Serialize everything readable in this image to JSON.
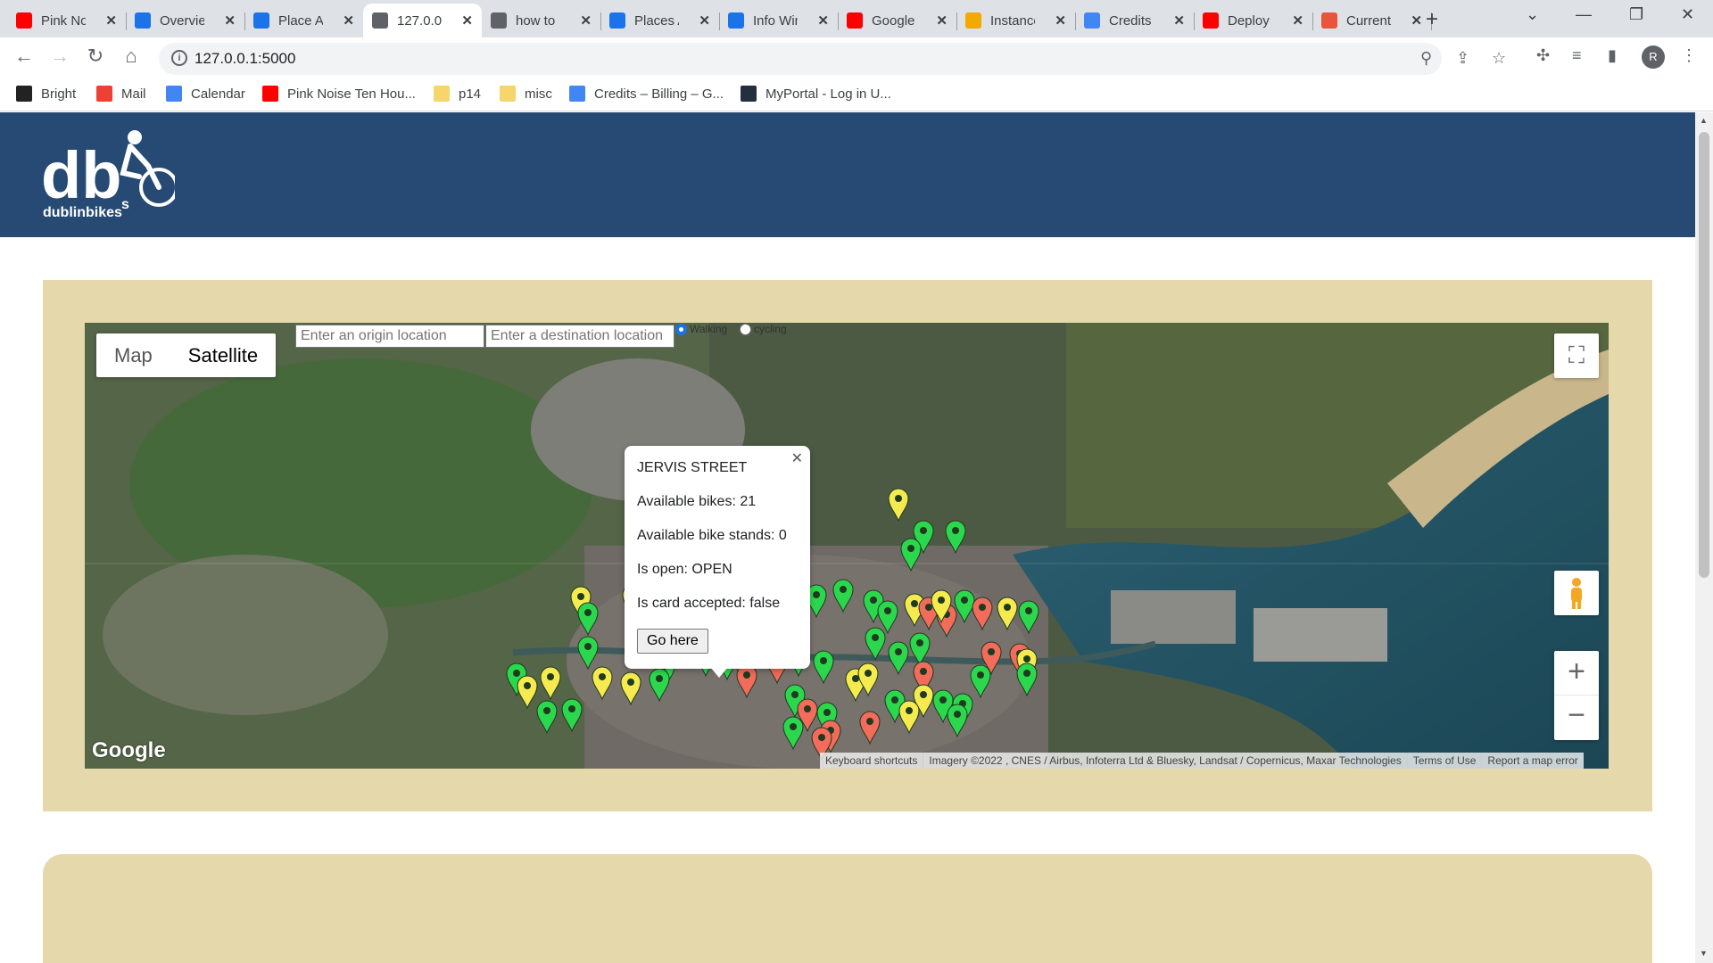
{
  "browser": {
    "tabs": [
      {
        "title": "Pink Noise",
        "favicon": "youtube-icon",
        "color": "#ff0000"
      },
      {
        "title": "Overview",
        "favicon": "cloud-dev-icon",
        "color": "#1a73e8"
      },
      {
        "title": "Place API",
        "favicon": "cloud-dev-icon",
        "color": "#1a73e8"
      },
      {
        "title": "127.0.0.1",
        "favicon": "globe-icon",
        "color": "#5f6368"
      },
      {
        "title": "how to",
        "favicon": "globe-icon",
        "color": "#5f6368"
      },
      {
        "title": "Places API",
        "favicon": "cloud-dev-icon",
        "color": "#1a73e8"
      },
      {
        "title": "Info Window",
        "favicon": "cloud-dev-icon",
        "color": "#1a73e8"
      },
      {
        "title": "Google",
        "favicon": "youtube-icon",
        "color": "#ff0000"
      },
      {
        "title": "Instances",
        "favicon": "box-icon",
        "color": "#f2a900"
      },
      {
        "title": "Credits",
        "favicon": "billing-icon",
        "color": "#4285f4"
      },
      {
        "title": "Deploy",
        "favicon": "youtube-icon",
        "color": "#ff0000"
      },
      {
        "title": "Current",
        "favicon": "octopus-icon",
        "color": "#e8553a"
      }
    ],
    "active_tab_index": 3,
    "url": "127.0.0.1:5000",
    "profile_initial": "R",
    "bookmarks": [
      {
        "label": "Bright",
        "icon": "d2l-icon",
        "color": "#222222"
      },
      {
        "label": "Mail",
        "icon": "gmail-icon",
        "color": "#ea4335"
      },
      {
        "label": "Calendar",
        "icon": "calendar-icon",
        "color": "#4285f4"
      },
      {
        "label": "Pink Noise Ten Hou...",
        "icon": "youtube-icon",
        "color": "#ff0000"
      },
      {
        "label": "p14",
        "icon": "folder-icon",
        "color": "#f6d56a"
      },
      {
        "label": "misc",
        "icon": "folder-icon",
        "color": "#f6d56a"
      },
      {
        "label": "Credits – Billing – G...",
        "icon": "billing-icon",
        "color": "#4285f4"
      },
      {
        "label": "MyPortal - Log in U...",
        "icon": "amazon-icon",
        "color": "#232f3e"
      }
    ]
  },
  "site": {
    "brand": "dublinbikes",
    "logo_letters": "db",
    "logo_sub": "s",
    "header_color": "#264a73",
    "panel_color": "#e5d8aa"
  },
  "map": {
    "type_controls": {
      "map": "Map",
      "satellite": "Satellite",
      "selected": "Satellite"
    },
    "origin_placeholder": "Enter an origin location",
    "destination_placeholder": "Enter a destination location",
    "travel_modes": [
      {
        "label": "Walking",
        "checked": true
      },
      {
        "label": "cycling",
        "checked": false
      }
    ],
    "google_logo": "Google",
    "attribution": [
      "Keyboard shortcuts",
      "Imagery ©2022 , CNES / Airbus, Infoterra Ltd & Bluesky, Landsat / Copernicus, Maxar Technologies",
      "Terms of Use",
      "Report a map error"
    ],
    "marker_colors": {
      "green": "#2bd84d",
      "yellow": "#f5ea4e",
      "red": "#f26b5b"
    },
    "info_window": {
      "station": "JERVIS STREET",
      "available_bikes": "Available bikes: 21",
      "available_stands": "Available bike stands: 0",
      "is_open": "Is open: OPEN",
      "card_accepted": "Is card accepted: false",
      "button": "Go here"
    }
  }
}
